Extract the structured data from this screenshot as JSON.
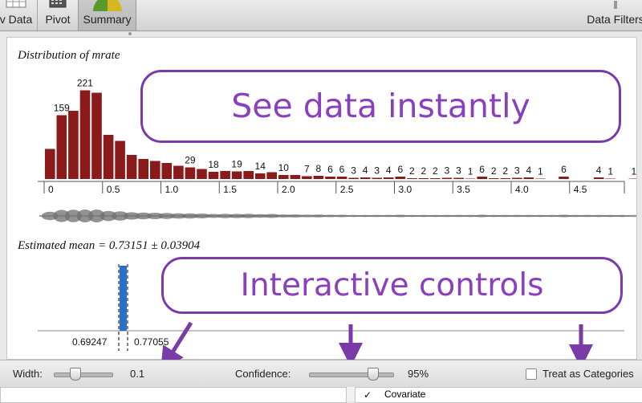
{
  "toolbar": {
    "view_data_label": "v Data",
    "pivot_label": "Pivot",
    "summary_label": "Summary",
    "data_filters_label": "Data Filters"
  },
  "histogram": {
    "title": "Distribution of mrate",
    "color": "#8b1a1a"
  },
  "mean_panel": {
    "title": "Estimated mean = 0.73151 ± 0.03904",
    "lower": "0.69247",
    "upper": "0.77055",
    "mean_value": 0.73151,
    "ci_color": "#2a6fc9"
  },
  "controls": {
    "width_label": "Width:",
    "width_value": "0.1",
    "width_slider_level": 0.35,
    "confidence_label": "Confidence:",
    "confidence_value": "95%",
    "confidence_slider_level": 0.75,
    "treat_label": "Treat as Categories",
    "treat_checked": false
  },
  "bottom": {
    "covariate_label": "Covariate"
  },
  "callouts": {
    "see_data": "See data instantly",
    "interactive": "Interactive controls",
    "accent": "#8a3fbf"
  },
  "chart_data": {
    "type": "bar",
    "title": "Distribution of mrate",
    "bin_width": 0.1,
    "xlim": [
      0,
      5.1
    ],
    "x_ticks": [
      "0",
      "0.5",
      "1.0",
      "1.5",
      "2.0",
      "2.5",
      "3.0",
      "3.5",
      "4.0",
      "4.5"
    ],
    "bin_starts": [
      0.0,
      0.1,
      0.2,
      0.3,
      0.4,
      0.5,
      0.6,
      0.7,
      0.8,
      0.9,
      1.0,
      1.1,
      1.2,
      1.3,
      1.4,
      1.5,
      1.6,
      1.7,
      1.8,
      1.9,
      2.0,
      2.1,
      2.2,
      2.3,
      2.4,
      2.5,
      2.6,
      2.7,
      2.8,
      2.9,
      3.0,
      3.1,
      3.2,
      3.3,
      3.4,
      3.5,
      3.6,
      3.7,
      3.8,
      3.9,
      4.0,
      4.1,
      4.2,
      4.3,
      4.4,
      4.5,
      4.6,
      4.7,
      4.8,
      4.9,
      5.0
    ],
    "values": [
      75,
      159,
      170,
      221,
      215,
      110,
      95,
      60,
      50,
      45,
      40,
      33,
      29,
      25,
      18,
      20,
      19,
      20,
      14,
      17,
      10,
      10,
      7,
      8,
      6,
      6,
      3,
      4,
      3,
      4,
      6,
      2,
      2,
      2,
      3,
      3,
      1,
      6,
      2,
      2,
      3,
      4,
      1,
      0,
      6,
      0,
      0,
      4,
      1,
      0,
      1
    ],
    "data_labels": [
      {
        "bin": 1,
        "text": "159"
      },
      {
        "bin": 3,
        "text": "221"
      },
      {
        "bin": 12,
        "text": "29"
      },
      {
        "bin": 14,
        "text": "18"
      },
      {
        "bin": 16,
        "text": "19"
      },
      {
        "bin": 18,
        "text": "14"
      },
      {
        "bin": 20,
        "text": "10"
      },
      {
        "bin": 22,
        "text": "7"
      },
      {
        "bin": 23,
        "text": "8"
      },
      {
        "bin": 24,
        "text": "6"
      },
      {
        "bin": 25,
        "text": "6"
      },
      {
        "bin": 26,
        "text": "3"
      },
      {
        "bin": 27,
        "text": "4"
      },
      {
        "bin": 28,
        "text": "3"
      },
      {
        "bin": 29,
        "text": "4"
      },
      {
        "bin": 30,
        "text": "6"
      },
      {
        "bin": 31,
        "text": "2"
      },
      {
        "bin": 32,
        "text": "2"
      },
      {
        "bin": 33,
        "text": "2"
      },
      {
        "bin": 34,
        "text": "3"
      },
      {
        "bin": 35,
        "text": "3"
      },
      {
        "bin": 36,
        "text": "1"
      },
      {
        "bin": 37,
        "text": "6"
      },
      {
        "bin": 38,
        "text": "2"
      },
      {
        "bin": 39,
        "text": "2"
      },
      {
        "bin": 40,
        "text": "3"
      },
      {
        "bin": 41,
        "text": "4"
      },
      {
        "bin": 42,
        "text": "1"
      },
      {
        "bin": 44,
        "text": "6"
      },
      {
        "bin": 47,
        "text": "4"
      },
      {
        "bin": 48,
        "text": "1"
      },
      {
        "bin": 50,
        "text": "1"
      }
    ],
    "ylim": [
      0,
      240
    ]
  }
}
